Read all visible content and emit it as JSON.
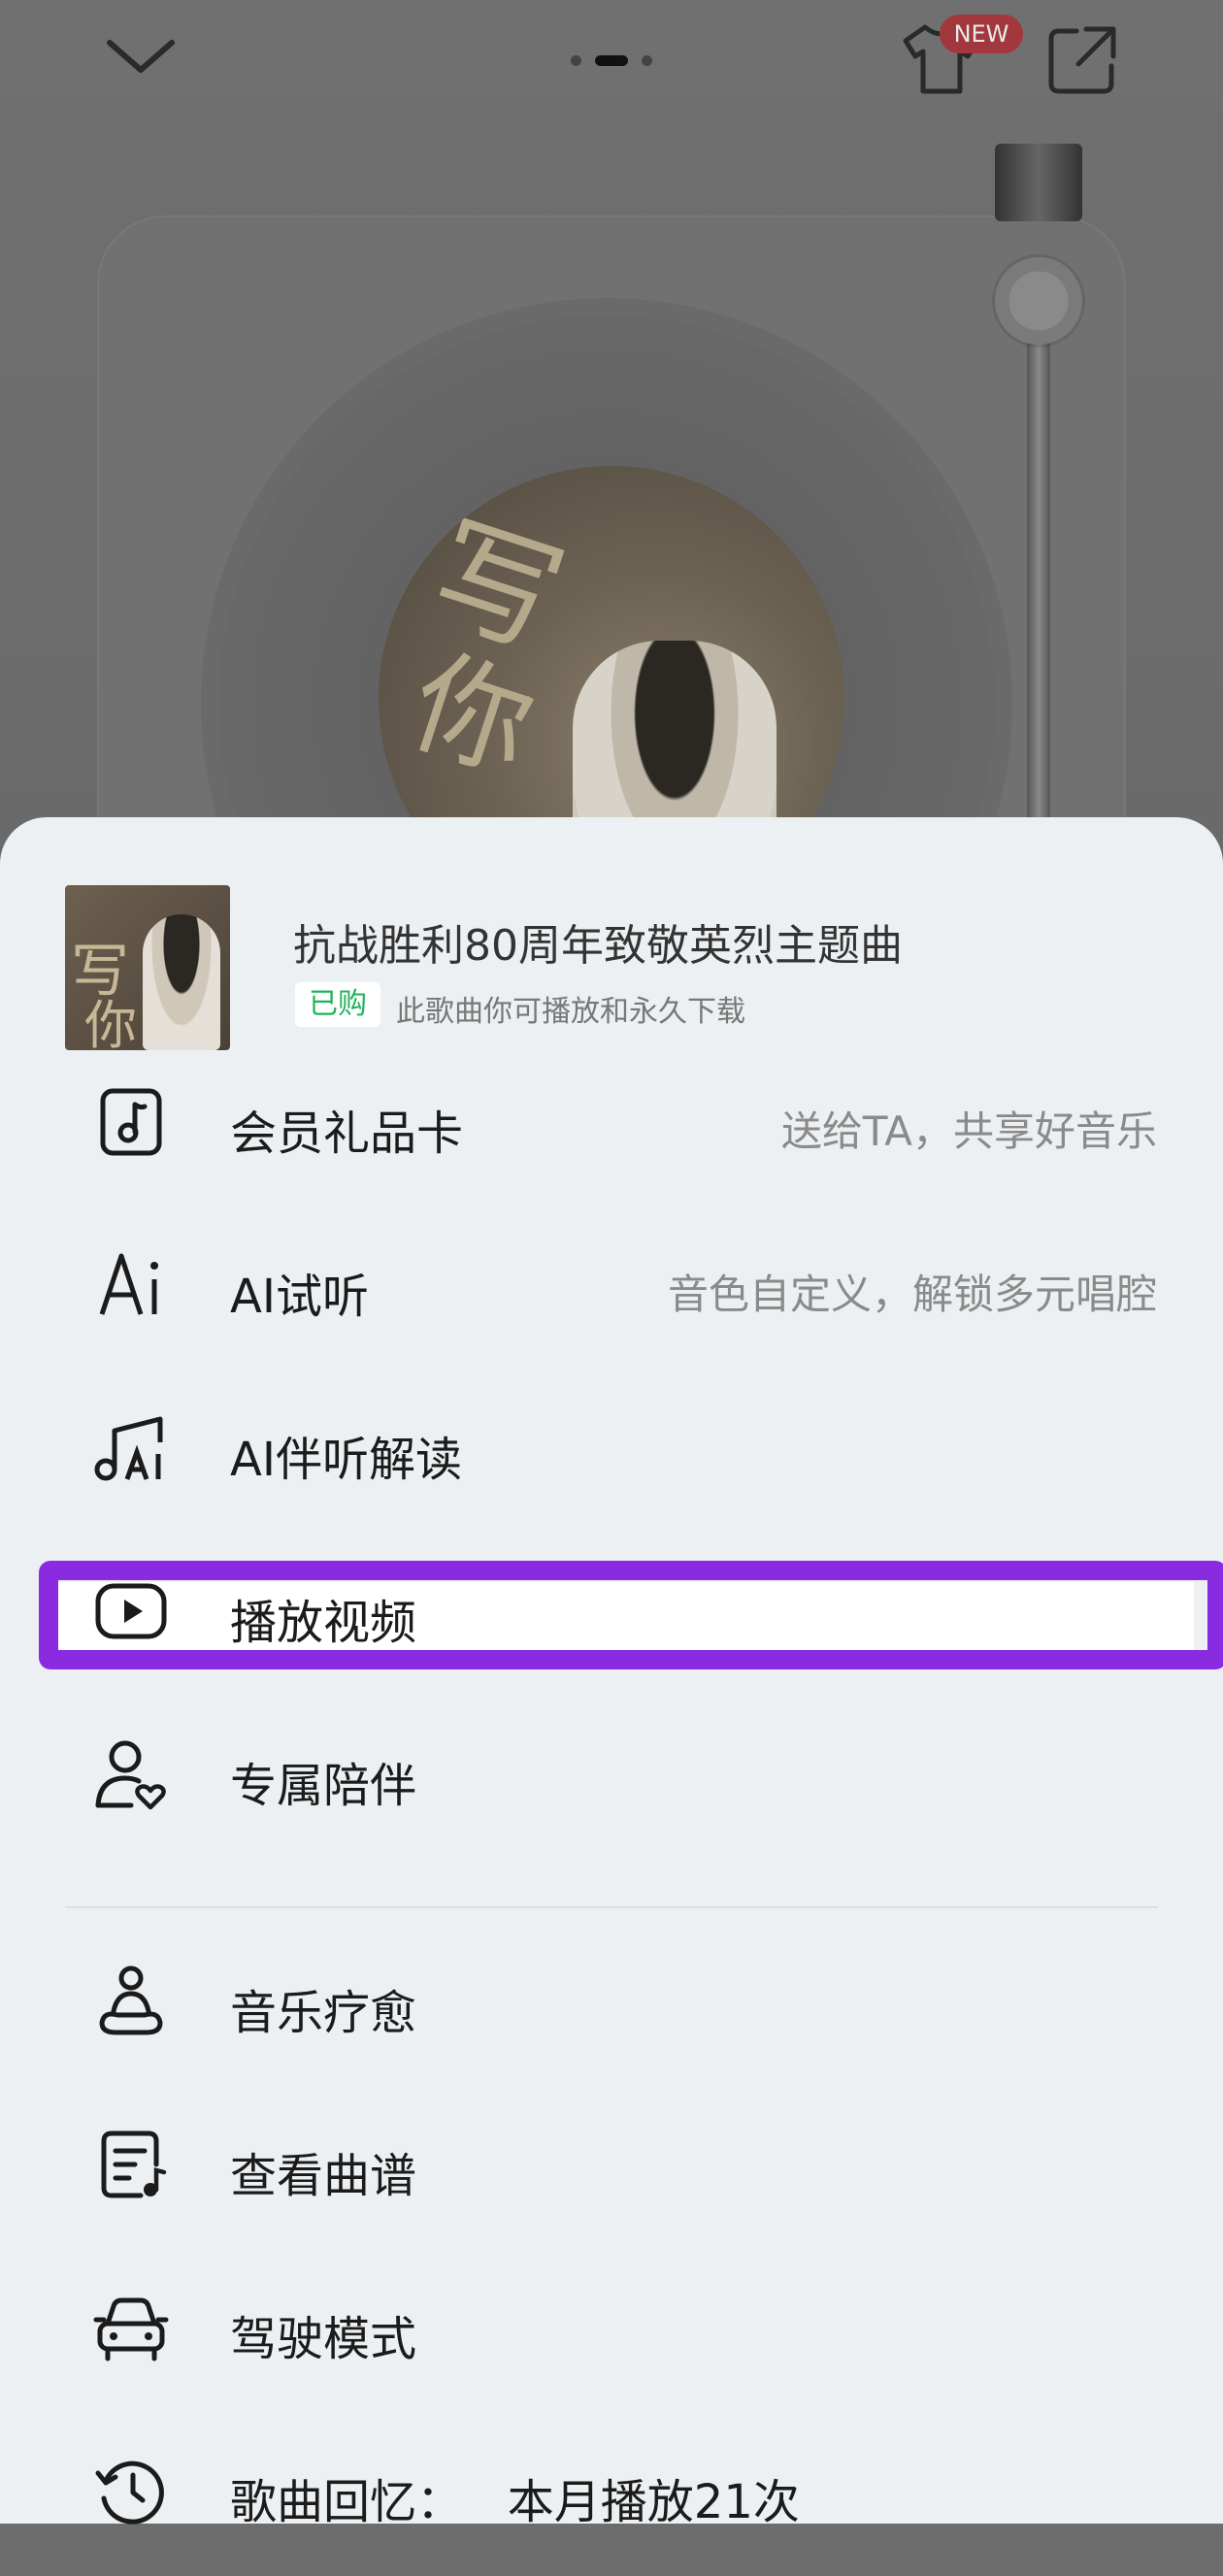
{
  "top_bar": {
    "new_badge": "NEW"
  },
  "song": {
    "title": "抗战胜利80周年致敬英烈主题曲",
    "title_visible": "抗战胜利80周年致敬英烈主题曲",
    "purchased_badge": "已购",
    "purchased_desc": "此歌曲你可播放和永久下载"
  },
  "menu": {
    "items": [
      {
        "icon": "music-card-icon",
        "label": "会员礼品卡",
        "hint": "送给TA，共享好音乐"
      },
      {
        "icon": "ai-icon",
        "label": "AI试听",
        "hint": "音色自定义，解锁多元唱腔"
      },
      {
        "icon": "music-ai-icon",
        "label": "AI伴听解读",
        "hint": ""
      },
      {
        "icon": "play-video-icon",
        "label": "播放视频",
        "hint": ""
      },
      {
        "icon": "companion-icon",
        "label": "专属陪伴",
        "hint": ""
      },
      {
        "icon": "meditation-icon",
        "label": "音乐疗愈",
        "hint": ""
      },
      {
        "icon": "sheet-music-icon",
        "label": "查看曲谱",
        "hint": ""
      },
      {
        "icon": "car-icon",
        "label": "驾驶模式",
        "hint": ""
      },
      {
        "icon": "history-icon",
        "label": "歌曲回忆：   本月播放21次",
        "hint": ""
      }
    ]
  },
  "colors": {
    "highlight": "#8a2be2",
    "purchased_green": "#22b35a",
    "sheet_bg": "#edf0f2"
  }
}
